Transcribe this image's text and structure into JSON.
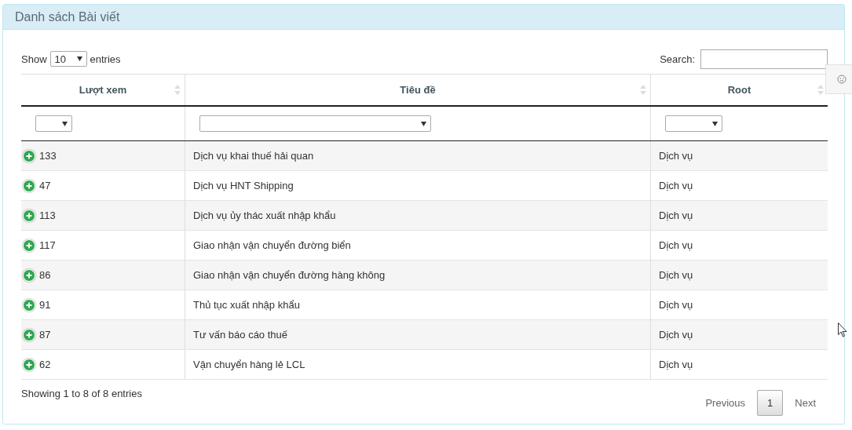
{
  "panel": {
    "title": "Danh sách Bài viết"
  },
  "length_menu": {
    "label_before": "Show",
    "value": "10",
    "label_after": "entries"
  },
  "search": {
    "label": "Search:"
  },
  "table": {
    "columns": [
      {
        "label": "Lượt xem"
      },
      {
        "label": "Tiêu đề"
      },
      {
        "label": "Root"
      }
    ],
    "rows": [
      {
        "views": "133",
        "title": "Dịch vụ khai thuế hải quan",
        "root": "Dịch vụ"
      },
      {
        "views": "47",
        "title": "Dịch vụ HNT Shipping",
        "root": "Dịch vụ"
      },
      {
        "views": "113",
        "title": "Dịch vụ ủy thác xuất nhập khẩu",
        "root": "Dịch vụ"
      },
      {
        "views": "117",
        "title": "Giao nhận vận chuyển đường biển",
        "root": "Dịch vụ"
      },
      {
        "views": "86",
        "title": "Giao nhận vận chuyển đường hàng không",
        "root": "Dịch vụ"
      },
      {
        "views": "91",
        "title": "Thủ tục xuất nhập khẩu",
        "root": "Dịch vụ"
      },
      {
        "views": "87",
        "title": "Tư vấn báo cáo thuế",
        "root": "Dịch vụ"
      },
      {
        "views": "62",
        "title": "Vận chuyển hàng lẻ LCL",
        "root": "Dịch vụ"
      }
    ]
  },
  "info": "Showing 1 to 8 of 8 entries",
  "pagination": {
    "previous": "Previous",
    "pages": [
      {
        "label": "1",
        "selected": true
      }
    ],
    "next": "Next"
  }
}
